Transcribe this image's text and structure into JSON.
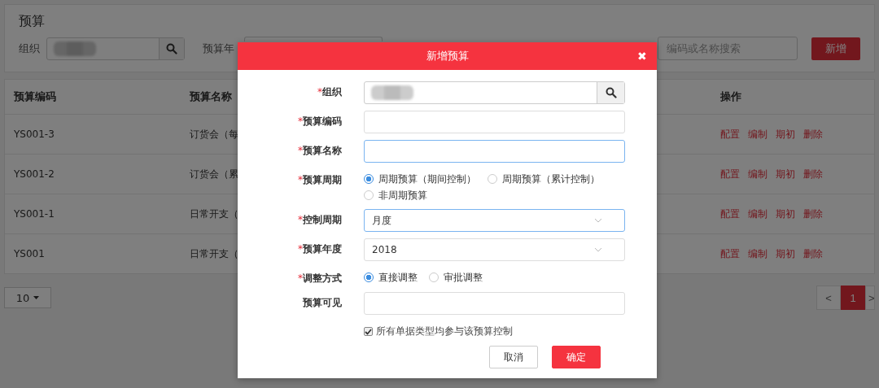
{
  "page": {
    "title": "预算",
    "org_label": "组织",
    "year_label": "预算年",
    "search": {
      "placeholder": "编码或名称搜索"
    },
    "add_button": "新增"
  },
  "table": {
    "columns": [
      "预算编码",
      "预算名称",
      "操作"
    ],
    "rows": [
      {
        "code": "YS001-3",
        "name": "订货会（每",
        "actions": [
          "配置",
          "编制",
          "期初",
          "删除"
        ]
      },
      {
        "code": "YS001-2",
        "name": "订货会（累",
        "actions": [
          "配置",
          "编制",
          "期初",
          "删除"
        ]
      },
      {
        "code": "YS001-1",
        "name": "日常开支（",
        "actions": [
          "配置",
          "编制",
          "期初",
          "删除"
        ]
      },
      {
        "code": "YS001",
        "name": "日常开支（",
        "actions": [
          "配置",
          "编制",
          "期初",
          "删除"
        ]
      }
    ]
  },
  "page_size": "10",
  "pagination": {
    "prev": "<",
    "pages": [
      {
        "label": "1",
        "selected": true
      }
    ],
    "next": ">"
  },
  "dialog": {
    "title": "新增预算",
    "close": "✖",
    "required_mark": "*",
    "fields": [
      {
        "kind": "search",
        "label": "组织",
        "required": true
      },
      {
        "kind": "text",
        "label": "预算编码",
        "required": true,
        "focused": false
      },
      {
        "kind": "text",
        "label": "预算名称",
        "required": true,
        "focused": true
      },
      {
        "kind": "radio",
        "label": "预算周期",
        "required": true,
        "options": [
          {
            "label": "周期预算（期间控制）",
            "selected": true
          },
          {
            "label": "周期预算（累计控制）",
            "selected": false
          },
          {
            "label": "非周期预算",
            "selected": false
          }
        ]
      },
      {
        "kind": "select",
        "label": "控制周期",
        "required": true,
        "value": "月度",
        "focused": true
      },
      {
        "kind": "select",
        "label": "预算年度",
        "required": true,
        "value": "2018",
        "focused": false
      },
      {
        "kind": "radio",
        "label": "调整方式",
        "required": true,
        "options": [
          {
            "label": "直接调整",
            "selected": true
          },
          {
            "label": "审批调整",
            "selected": false
          }
        ]
      },
      {
        "kind": "text",
        "label": "预算可见",
        "required": false,
        "focused": false
      }
    ],
    "checkbox": {
      "label": "所有单据类型均参与该预算控制",
      "checked": true
    },
    "buttons": [
      {
        "label": "取消",
        "kind": "secondary"
      },
      {
        "label": "确定",
        "kind": "primary"
      }
    ]
  }
}
